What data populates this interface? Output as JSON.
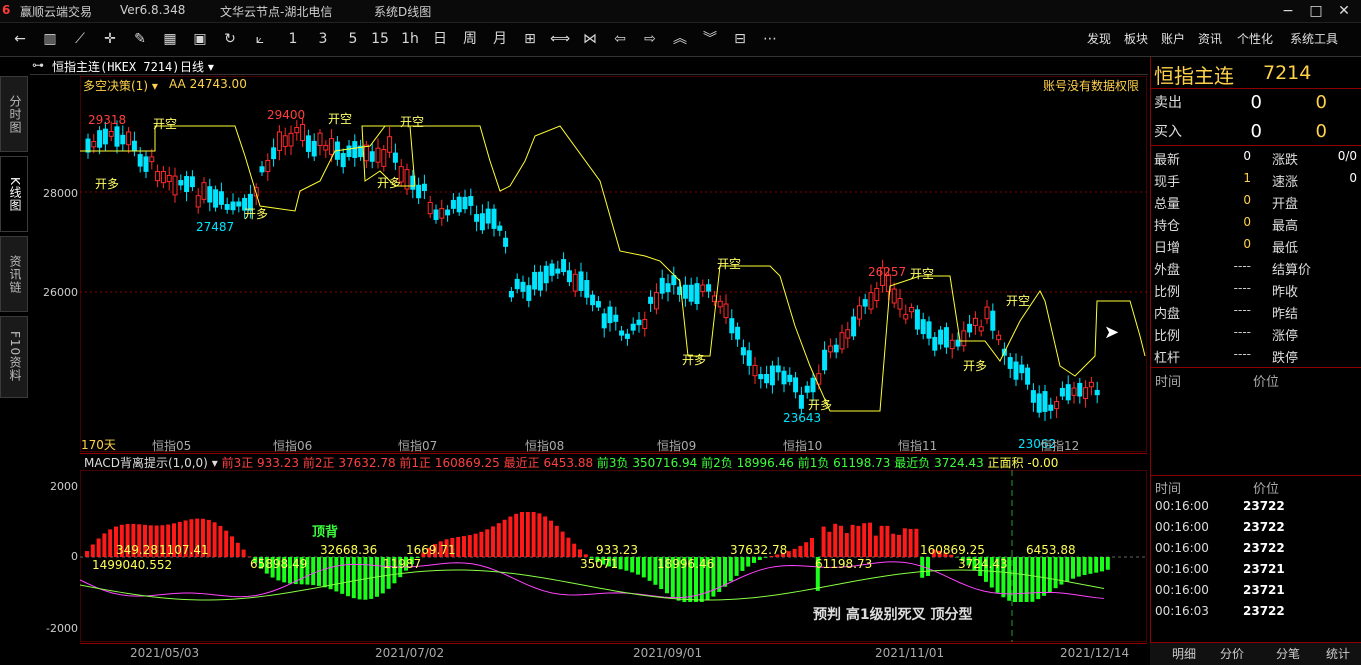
{
  "titlebar": {
    "app_name": "赢顺云端交易",
    "version": "Ver6.8.348",
    "server": "文华云节点-湖北电信",
    "menu_label": "系统D线图"
  },
  "toolbar": {
    "periods": [
      "1",
      "3",
      "5",
      "15",
      "1h",
      "日",
      "周",
      "月"
    ],
    "right_menu": [
      "发现",
      "板块",
      "账户",
      "资讯",
      "个性化",
      "系统工具"
    ]
  },
  "left_tabs": [
    "分时图",
    "K线图",
    "资讯链",
    "F10资料"
  ],
  "chart_header": {
    "symbol": "恒指主连(HKEX 7214)",
    "period": "日线",
    "indicator": "多空决策(1)",
    "aa_label": "AA 24743.00",
    "no_permission": "账号没有数据权限",
    "days": "170天"
  },
  "chart_data": {
    "type": "candlestick",
    "y_ticks": [
      "28000",
      "26000"
    ],
    "x_month_labels": [
      "恒指05",
      "恒指06",
      "恒指07",
      "恒指08",
      "恒指09",
      "恒指10",
      "恒指11",
      "恒指12"
    ],
    "date_labels": [
      "2021/05/03",
      "2021/07/02",
      "2021/09/01",
      "2021/11/01",
      "2021/12/14"
    ],
    "price_annotations": [
      "29318",
      "29400",
      "27487",
      "23643",
      "26257",
      "23062"
    ],
    "signal_labels": [
      "开空",
      "开多"
    ],
    "macd": {
      "header": "MACD背离提示(1,0,0)",
      "items": [
        {
          "label": "前3正",
          "value": "933.23"
        },
        {
          "label": "前2正",
          "value": "37632.78"
        },
        {
          "label": "前1正",
          "value": "160869.25"
        },
        {
          "label": "最近正",
          "value": "6453.88"
        },
        {
          "label": "前3负",
          "value": "350716.94"
        },
        {
          "label": "前2负",
          "value": "18996.46"
        },
        {
          "label": "前1负",
          "value": "61198.73"
        },
        {
          "label": "最近负",
          "value": "3724.43"
        },
        {
          "label": "正面积",
          "value": "-0.00"
        }
      ],
      "y_ticks": [
        "2000",
        "0",
        "-2000"
      ],
      "annotations": [
        "349.28",
        "1107.41",
        "1499040.552",
        "32668.36",
        "65898.49",
        "1669.71",
        "11987",
        "933.23",
        "35071",
        "18996.46",
        "37632.78",
        "61198.73",
        "160869.25",
        "3724.43",
        "6453.88"
      ],
      "text_top_diverge": "顶背",
      "bottom_text": "预判 高1级别死叉 顶分型"
    }
  },
  "quote_panel": {
    "name": "恒指主连",
    "code": "7214",
    "sell_label": "卖出",
    "sell_price": "0",
    "sell_vol": "0",
    "buy_label": "买入",
    "buy_price": "0",
    "buy_vol": "0",
    "left_items": [
      {
        "label": "最新",
        "value": "0"
      },
      {
        "label": "现手",
        "value": "1"
      },
      {
        "label": "总量",
        "value": "0"
      },
      {
        "label": "持仓",
        "value": "0"
      },
      {
        "label": "日增",
        "value": "0"
      },
      {
        "label": "外盘",
        "value": "----"
      },
      {
        "label": "比例",
        "value": "----"
      },
      {
        "label": "内盘",
        "value": "----"
      },
      {
        "label": "比例",
        "value": "----"
      },
      {
        "label": "杠杆",
        "value": "----"
      }
    ],
    "right_items": [
      {
        "label": "涨跌",
        "value": "0/0"
      },
      {
        "label": "速涨",
        "value": "0"
      },
      {
        "label": "开盘",
        "value": ""
      },
      {
        "label": "最高",
        "value": ""
      },
      {
        "label": "最低",
        "value": ""
      },
      {
        "label": "结算价",
        "value": ""
      },
      {
        "label": "昨收",
        "value": ""
      },
      {
        "label": "昨结",
        "value": ""
      },
      {
        "label": "涨停",
        "value": ""
      },
      {
        "label": "跌停",
        "value": ""
      }
    ],
    "trade_header_time": "时间",
    "trade_header_price": "价位",
    "ticks_header_time": "时间",
    "ticks_header_price": "价位",
    "ticks": [
      {
        "time": "00:16:00",
        "price": "23722"
      },
      {
        "time": "00:16:00",
        "price": "23722"
      },
      {
        "time": "00:16:00",
        "price": "23722"
      },
      {
        "time": "00:16:00",
        "price": "23721"
      },
      {
        "time": "00:16:00",
        "price": "23721"
      },
      {
        "time": "00:16:03",
        "price": "23722"
      }
    ],
    "bottom_tabs": [
      "明细",
      "分价",
      "分笔",
      "统计"
    ]
  },
  "colors": {
    "up": "#ff2a2a",
    "down": "#00e5ff",
    "line": "#ffff33",
    "macd_pos": "#ff1a1a",
    "macd_neg": "#1aff1a",
    "border": "#8b0000"
  }
}
